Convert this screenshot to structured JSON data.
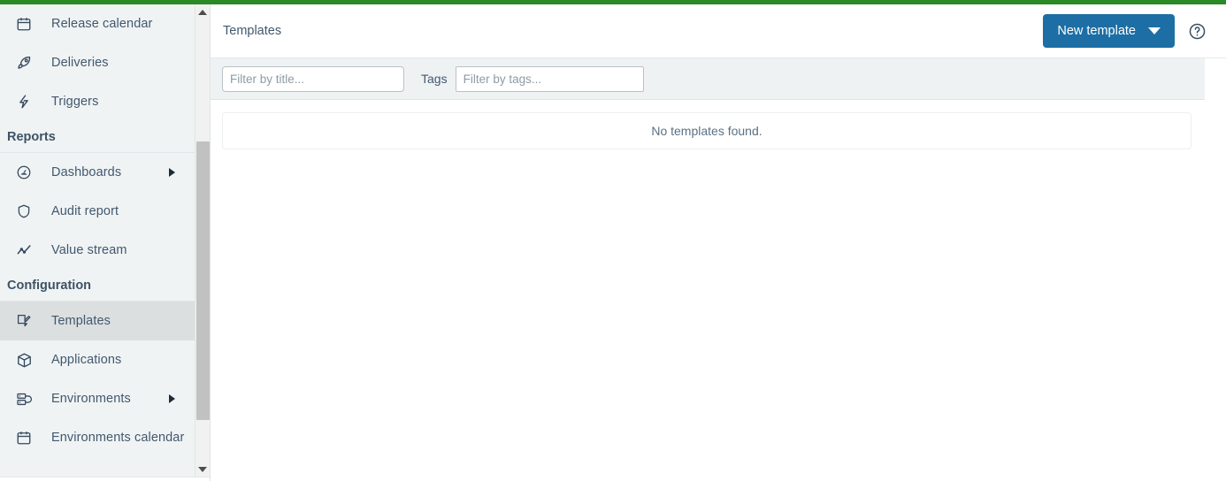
{
  "theme": {
    "accent_bar_color": "#2a8a26",
    "primary_button_color": "#1c6ea4",
    "sidebar_bg": "#f0f3f4",
    "active_item_bg": "#dcdfe0",
    "filter_bar_bg": "#eff2f3",
    "text_color": "#41586e"
  },
  "sidebar": {
    "items": [
      {
        "label": "Release calendar",
        "icon": "calendar-icon",
        "active": false,
        "has_submenu": false
      },
      {
        "label": "Deliveries",
        "icon": "rocket-icon",
        "active": false,
        "has_submenu": false
      },
      {
        "label": "Triggers",
        "icon": "lightning-bolt-icon",
        "active": false,
        "has_submenu": false
      }
    ],
    "sections": [
      {
        "title": "Reports",
        "items": [
          {
            "label": "Dashboards",
            "icon": "gauge-icon",
            "active": false,
            "has_submenu": true
          },
          {
            "label": "Audit report",
            "icon": "shield-icon",
            "active": false,
            "has_submenu": false
          },
          {
            "label": "Value stream",
            "icon": "trend-line-icon",
            "active": false,
            "has_submenu": false
          }
        ]
      },
      {
        "title": "Configuration",
        "items": [
          {
            "label": "Templates",
            "icon": "template-pen-icon",
            "active": true,
            "has_submenu": false
          },
          {
            "label": "Applications",
            "icon": "cube-icon",
            "active": false,
            "has_submenu": false
          },
          {
            "label": "Environments",
            "icon": "server-stack-icon",
            "active": false,
            "has_submenu": true
          },
          {
            "label": "Environments calendar",
            "icon": "calendar-icon",
            "active": false,
            "has_submenu": false
          }
        ]
      }
    ],
    "scrollbar": {
      "up_arrow": "chevron-up-icon",
      "down_arrow": "chevron-down-icon"
    }
  },
  "header": {
    "title": "Templates",
    "new_template_label": "New template",
    "dropdown_icon": "chevron-down-icon",
    "help_icon": "help-circle-icon"
  },
  "filters": {
    "title_placeholder": "Filter by title...",
    "title_value": "",
    "tags_label": "Tags",
    "tags_placeholder": "Filter by tags...",
    "tags_value": ""
  },
  "results": {
    "empty_message": "No templates found."
  }
}
